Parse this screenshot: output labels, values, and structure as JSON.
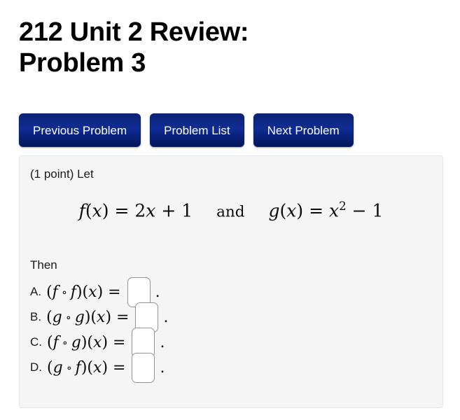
{
  "page": {
    "title": "212 Unit 2 Review: Problem 3"
  },
  "nav": {
    "buttons": [
      {
        "label": "Previous Problem",
        "name": "previous-problem-button"
      },
      {
        "label": "Problem List",
        "name": "problem-list-button"
      },
      {
        "label": "Next Problem",
        "name": "next-problem-button"
      }
    ]
  },
  "problem": {
    "points_text": "(1 point) Let",
    "then_text": "Then",
    "formula": {
      "f_name": "f",
      "f_arg_open": "(",
      "f_var": "x",
      "f_arg_close": ")",
      "equals": "=",
      "f_coefficient": "2",
      "f_var2": "x",
      "f_plus": "+",
      "f_constant": "1",
      "conjunction": "and",
      "g_name": "g",
      "g_arg_open": "(",
      "g_var": "x",
      "g_arg_close": ")",
      "g_equals": "=",
      "g_base": "x",
      "g_exponent": "2",
      "g_minus": "−",
      "g_constant": "1",
      "plain_text": "f(x) = 2x + 1   and   g(x) = x^2 - 1"
    },
    "answers": [
      {
        "label": "A.",
        "open_paren": "(",
        "left_fn": "f",
        "composition_operator": "∘",
        "right_fn": "f",
        "close_paren": ")",
        "arg_open": "(",
        "arg": "x",
        "arg_close": ")",
        "equals": "=",
        "value": "",
        "placeholder": "",
        "period": ".",
        "plain_text": "A. (f ∘ f)(x) ="
      },
      {
        "label": "B.",
        "open_paren": "(",
        "left_fn": "g",
        "composition_operator": "∘",
        "right_fn": "g",
        "close_paren": ")",
        "arg_open": "(",
        "arg": "x",
        "arg_close": ")",
        "equals": "=",
        "value": "",
        "placeholder": "",
        "period": ".",
        "plain_text": "B. (g ∘ g)(x) ="
      },
      {
        "label": "C.",
        "open_paren": "(",
        "left_fn": "f",
        "composition_operator": "∘",
        "right_fn": "g",
        "close_paren": ")",
        "arg_open": "(",
        "arg": "x",
        "arg_close": ")",
        "equals": "=",
        "value": "",
        "placeholder": "",
        "period": ".",
        "plain_text": "C. (f ∘ g)(x) ="
      },
      {
        "label": "D.",
        "open_paren": "(",
        "left_fn": "g",
        "composition_operator": "∘",
        "right_fn": "f",
        "close_paren": ")",
        "arg_open": "(",
        "arg": "x",
        "arg_close": ")",
        "equals": "=",
        "value": "",
        "placeholder": "",
        "period": ".",
        "plain_text": "D. (g ∘ f)(x) ="
      }
    ]
  },
  "colors": {
    "button_blue_top": "#0c2273",
    "button_blue_mid": "#102d96",
    "button_blue_bottom": "#05175a",
    "panel_background": "#f5f5f5",
    "panel_border": "#e6e6e6",
    "input_border": "#949494",
    "page_background": "#ffffff",
    "text": "#000000"
  }
}
